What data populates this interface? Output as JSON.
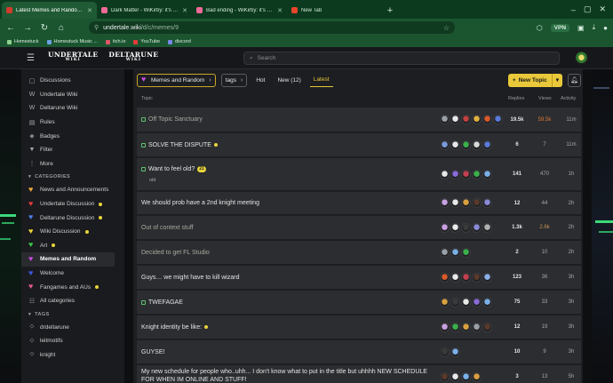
{
  "browser": {
    "tabs": [
      {
        "title": "Latest Memes and Random topics",
        "active": true,
        "favicon_color": "#d33a2c"
      },
      {
        "title": "Dark Matter - WiKirby: it's a wiki",
        "active": false,
        "favicon_color": "#f06a9a"
      },
      {
        "title": "Bad ending - WiKirby: it's a wiki",
        "active": false,
        "favicon_color": "#f06a9a"
      },
      {
        "title": "New Tab",
        "active": false,
        "favicon_color": "#e8452c"
      }
    ],
    "new_tab_symbol": "+",
    "url_main": "undertale.wiki",
    "url_rest": "/d/c/memes/9",
    "vpn_label": "VPN",
    "bookmarks": [
      {
        "label": "Homestuck",
        "color": "#8fd18f"
      },
      {
        "label": "Homestuck Music ...",
        "color": "#6aa0e0"
      },
      {
        "label": "itch.io",
        "color": "#e0566a"
      },
      {
        "label": "YouTube",
        "color": "#e53a3a"
      },
      {
        "label": "discord",
        "color": "#7a86e8"
      }
    ]
  },
  "header": {
    "logo_undertale": "UNDERTALE",
    "logo_undertale_sub": "WIKI",
    "logo_deltarune": "DELTARUNE",
    "logo_deltarune_sub": "WIKI",
    "search_placeholder": "Search"
  },
  "sidebar": {
    "nav": [
      {
        "label": "Discussions",
        "icon": "discussions-icon",
        "glyph": "▢"
      },
      {
        "label": "Undertale Wiki",
        "icon": "wiki-icon",
        "glyph": "W"
      },
      {
        "label": "Deltarune Wiki",
        "icon": "wiki-icon",
        "glyph": "W"
      },
      {
        "label": "Rules",
        "icon": "rules-icon",
        "glyph": "▤"
      },
      {
        "label": "Badges",
        "icon": "badge-icon",
        "glyph": "◈"
      },
      {
        "label": "Filter",
        "icon": "filter-icon",
        "glyph": "▼"
      },
      {
        "label": "More",
        "icon": "more-icon",
        "glyph": "⋮"
      }
    ],
    "categories_heading": "CATEGORIES",
    "categories": [
      {
        "label": "News and Announcements",
        "color": "#e8a53a",
        "unread": false
      },
      {
        "label": "Undertale Discussion",
        "color": "#e03a3a",
        "unread": true
      },
      {
        "label": "Deltarune Discussion",
        "color": "#4a7be0",
        "unread": true
      },
      {
        "label": "Wiki Discussion",
        "color": "#e9d53a",
        "unread": true
      },
      {
        "label": "Art",
        "color": "#3ac24a",
        "unread": true
      },
      {
        "label": "Memes and Random",
        "color": "#c64ae0",
        "unread": false,
        "active": true
      },
      {
        "label": "Welcome",
        "color": "#3a58e0",
        "unread": false
      },
      {
        "label": "Fangames and AUs",
        "color": "#e05a8a",
        "unread": true
      },
      {
        "label": "All categories",
        "color": "",
        "unread": false
      }
    ],
    "tags_heading": "TAGS",
    "tags": [
      {
        "label": "drdeltarune"
      },
      {
        "label": "leitmotifs"
      },
      {
        "label": "knight"
      }
    ]
  },
  "controls": {
    "category_chip": "Memes and Random",
    "tags_chip": "tags",
    "tabs": [
      {
        "label": "Hot",
        "active": false
      },
      {
        "label": "New (12)",
        "active": false
      },
      {
        "label": "Latest",
        "active": true
      }
    ],
    "new_topic_label": "New Topic"
  },
  "table": {
    "headers": {
      "topic": "Topic",
      "replies": "Replies",
      "views": "Views",
      "activity": "Activity"
    },
    "rows": [
      {
        "title": "Off Topic Sanctuary",
        "pinned": true,
        "visited": true,
        "unread": false,
        "badge": "",
        "sub": "",
        "replies": "19.5k",
        "views": "59.5k",
        "views_heat": "hot",
        "activity": "11m",
        "posters": [
          "#9aa0a8",
          "#e8e8e8",
          "#c04040",
          "#e0b040",
          "#d85a2a",
          "#5a7ad8"
        ]
      },
      {
        "title": "SOLVE THE DISPUTE",
        "pinned": true,
        "visited": false,
        "unread": true,
        "badge": "",
        "sub": "",
        "replies": "6",
        "views": "7",
        "views_heat": "",
        "activity": "11m",
        "posters": [
          "#7a9ad8",
          "#e8e8e8",
          "#3ab04a",
          "#d8d8d8",
          "#5a7ad8"
        ]
      },
      {
        "title": "Want to feel old?",
        "pinned": true,
        "visited": false,
        "unread": false,
        "badge": "21",
        "sub": "old",
        "replies": "141",
        "views": "470",
        "views_heat": "",
        "activity": "1h",
        "posters": [
          "#e8e8e8",
          "#8a6ad8",
          "#c04050",
          "#3ab04a",
          "#7ab0e8"
        ]
      },
      {
        "title": "We should prob have a 2nd knight meeting",
        "pinned": false,
        "visited": false,
        "unread": false,
        "badge": "",
        "sub": "",
        "replies": "12",
        "views": "44",
        "views_heat": "",
        "activity": "2h",
        "posters": [
          "#c8a0e0",
          "#e8e8e8",
          "#d8a040",
          "#5a3a2a",
          "#8a8ad8"
        ]
      },
      {
        "title": "Out of context stuff",
        "pinned": false,
        "visited": true,
        "unread": false,
        "badge": "",
        "sub": "",
        "replies": "1.3k",
        "views": "2.6k",
        "views_heat": "warm",
        "activity": "2h",
        "posters": [
          "#c8a0e0",
          "#e8e8e8",
          "#3a3a3a",
          "#8a8ad8",
          "#b0b0b0"
        ]
      },
      {
        "title": "Decided to get FL Studio",
        "pinned": false,
        "visited": true,
        "unread": false,
        "badge": "",
        "sub": "",
        "replies": "2",
        "views": "10",
        "views_heat": "",
        "activity": "2h",
        "posters": [
          "#9aa0a8",
          "#7ab0e8",
          "#3ab04a"
        ]
      },
      {
        "title": "Guys… we might have to kill wizard",
        "pinned": false,
        "visited": false,
        "unread": false,
        "badge": "",
        "sub": "",
        "replies": "123",
        "views": "36",
        "views_heat": "",
        "activity": "3h",
        "posters": [
          "#d85a2a",
          "#e8e8e8",
          "#c04050",
          "#5a3a2a",
          "#8ab0e8"
        ]
      },
      {
        "title": "TWEFAGAE",
        "pinned": true,
        "visited": false,
        "unread": false,
        "badge": "",
        "sub": "",
        "replies": "75",
        "views": "33",
        "views_heat": "",
        "activity": "3h",
        "posters": [
          "#d8a040",
          "#3a3a3a",
          "#e8e8e8",
          "#8a6ad8",
          "#7ab0e8"
        ]
      },
      {
        "title": "Knight identity be like:",
        "pinned": false,
        "visited": false,
        "unread": true,
        "badge": "",
        "sub": "",
        "replies": "12",
        "views": "19",
        "views_heat": "",
        "activity": "3h",
        "posters": [
          "#c8a0e0",
          "#3ab04a",
          "#d8a040",
          "#9aa0a8",
          "#5a3a2a"
        ]
      },
      {
        "title": "GUYSE!",
        "pinned": false,
        "visited": false,
        "unread": false,
        "badge": "",
        "sub": "",
        "replies": "10",
        "views": "9",
        "views_heat": "",
        "activity": "3h",
        "posters": [
          "#3a3a3a",
          "#7ab0e8"
        ]
      },
      {
        "title": "My new schedule for people who..uhh... I don't know what to put in the title but uhhhh NEW SCHEDULE FOR WHEN IM ONLINE AND STUFF!",
        "pinned": false,
        "visited": false,
        "unread": false,
        "badge": "",
        "sub": "",
        "replies": "3",
        "views": "13",
        "views_heat": "",
        "activity": "5h",
        "posters": [
          "#5a3a2a",
          "#e8e8e8",
          "#7ab0e8",
          "#d8a040"
        ]
      }
    ]
  }
}
